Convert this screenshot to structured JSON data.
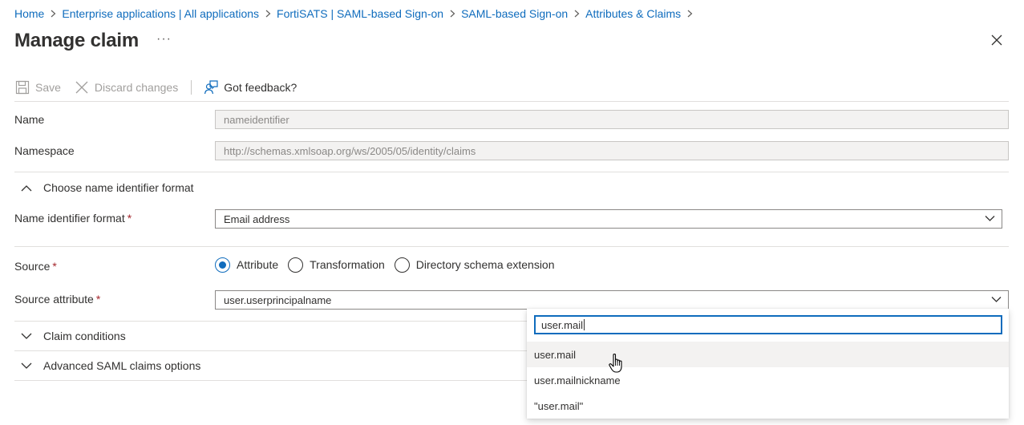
{
  "breadcrumb": [
    {
      "label": "Home"
    },
    {
      "label": "Enterprise applications | All applications"
    },
    {
      "label": "FortiSATS | SAML-based Sign-on"
    },
    {
      "label": "SAML-based Sign-on"
    },
    {
      "label": "Attributes & Claims"
    }
  ],
  "header": {
    "title": "Manage claim",
    "more": "···"
  },
  "toolbar": {
    "save_label": "Save",
    "discard_label": "Discard changes",
    "feedback_label": "Got feedback?"
  },
  "form": {
    "name_label": "Name",
    "name_value": "nameidentifier",
    "namespace_label": "Namespace",
    "namespace_value": "http://schemas.xmlsoap.org/ws/2005/05/identity/claims",
    "nid_section_label": "Choose name identifier format",
    "nid_format_label": "Name identifier format",
    "nid_format_value": "Email address",
    "required_marker": "*",
    "source_label": "Source",
    "source_options": [
      {
        "label": "Attribute",
        "checked": true
      },
      {
        "label": "Transformation",
        "checked": false
      },
      {
        "label": "Directory schema extension",
        "checked": false
      }
    ],
    "source_attribute_label": "Source attribute",
    "source_attribute_value": "user.userprincipalname",
    "claim_conditions_label": "Claim conditions",
    "advanced_label": "Advanced SAML claims options"
  },
  "popup": {
    "search_value": "user.mail",
    "options": [
      {
        "label": "user.mail",
        "hovered": true
      },
      {
        "label": "user.mailnickname",
        "hovered": false
      },
      {
        "label": "\"user.mail\"",
        "hovered": false
      }
    ]
  },
  "colors": {
    "accent": "#0f6cbd",
    "required": "#a4262c",
    "disabled_text": "#a19f9d",
    "readonly_bg": "#f3f2f1"
  }
}
